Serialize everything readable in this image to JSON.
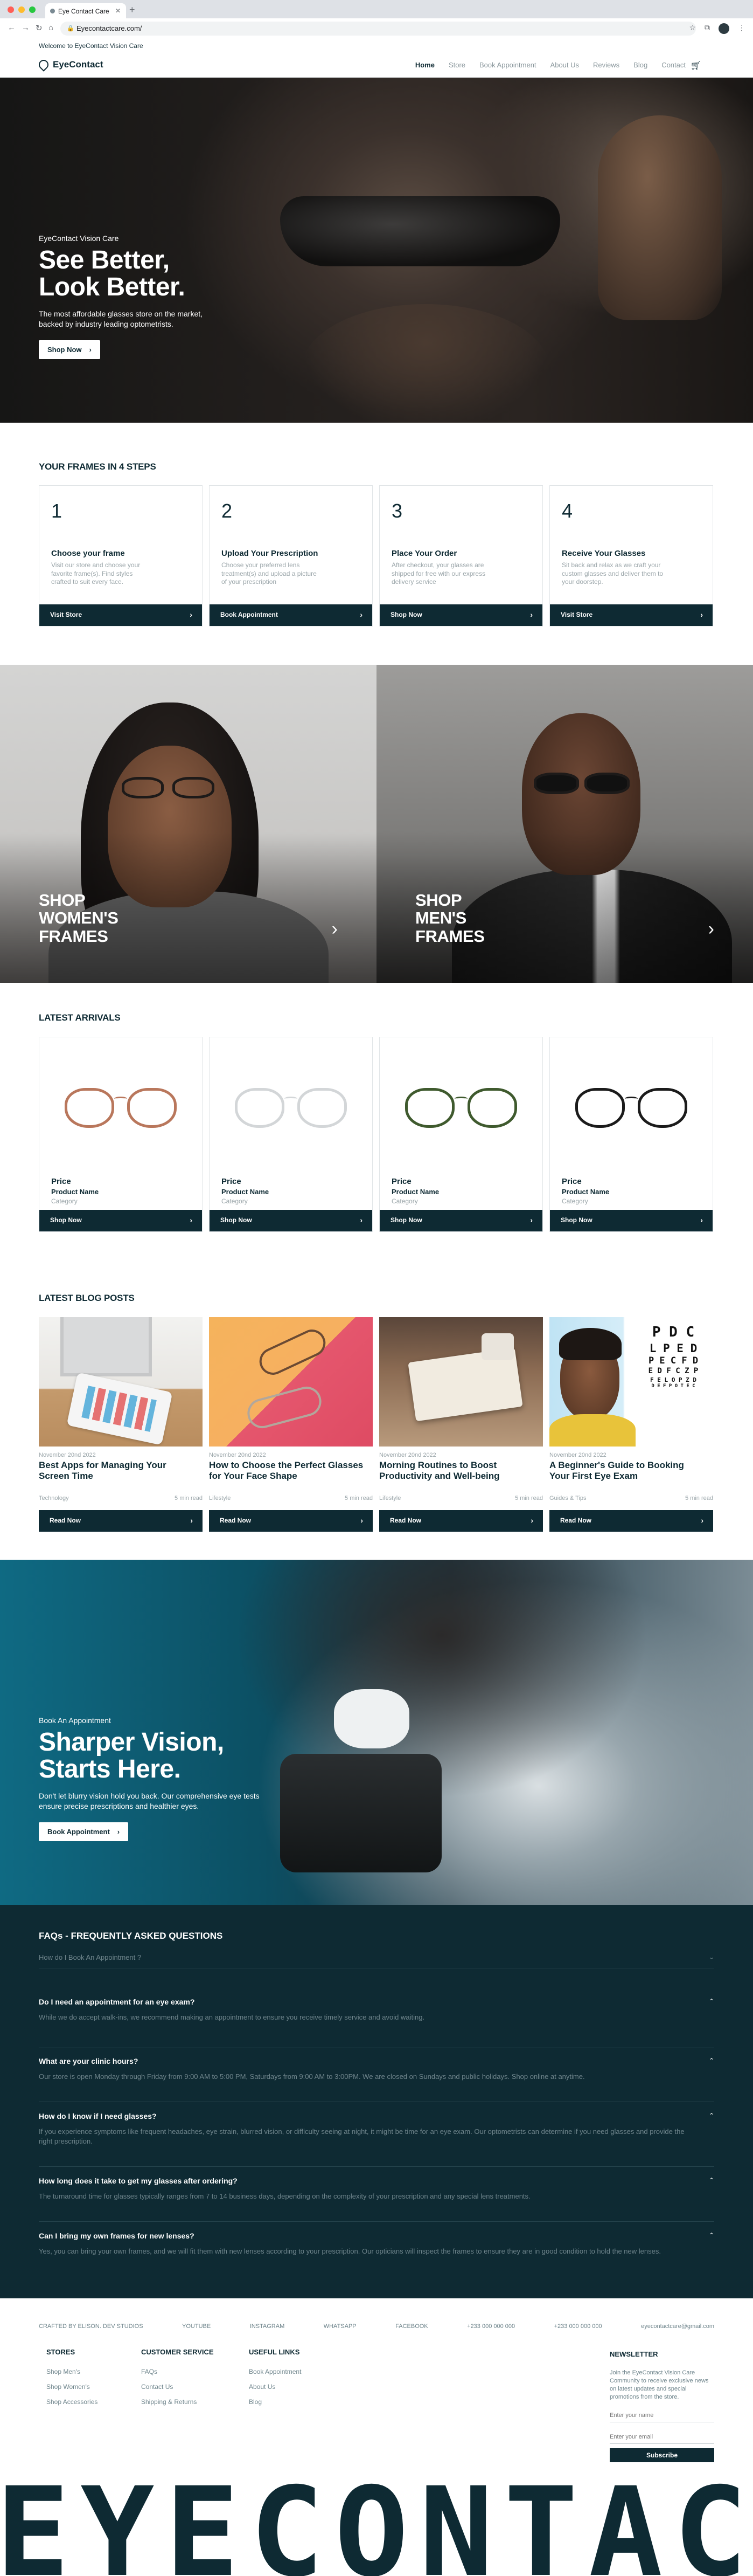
{
  "browser": {
    "tab_title": "Eye Contact Care",
    "url": "Eyecontactcare.com/"
  },
  "announcement": "Welcome to EyeContact Vision Care",
  "header": {
    "logo_text": "EyeContact",
    "nav": [
      "Home",
      "Store",
      "Book Appointment",
      "About Us",
      "Reviews",
      "Blog",
      "Contact"
    ],
    "active_nav": "Home",
    "cart_icon": "cart-icon"
  },
  "hero": {
    "eyebrow": "EyeContact Vision Care",
    "title_line1": "See Better,",
    "title_line2": "Look Better.",
    "subtitle": "The most affordable glasses store on the market, backed by industry leading optometrists.",
    "button": "Shop Now"
  },
  "steps": {
    "title": "YOUR FRAMES IN 4 STEPS",
    "items": [
      {
        "num": "1",
        "title": "Choose your frame",
        "desc": "Visit our store and choose your favorite frame(s). Find styles crafted to suit every face.",
        "button": "Visit Store"
      },
      {
        "num": "2",
        "title": "Upload Your Prescription",
        "desc": "Choose your preferred lens treatment(s) and upload a picture of your prescription",
        "button": "Book Appointment"
      },
      {
        "num": "3",
        "title": "Place Your Order",
        "desc": "After checkout, your glasses are shipped for free with our express delivery service",
        "button": "Shop Now"
      },
      {
        "num": "4",
        "title": "Receive Your Glasses",
        "desc": "Sit back and relax as we craft your custom glasses and deliver them to your doorstep.",
        "button": "Visit Store"
      }
    ]
  },
  "shop_panels": {
    "women": {
      "line1": "SHOP",
      "line2": "WOMEN'S",
      "line3": "FRAMES"
    },
    "men": {
      "line1": "SHOP",
      "line2": "MEN'S",
      "line3": "FRAMES"
    }
  },
  "arrivals": {
    "title": "LATEST ARRIVALS",
    "items": [
      {
        "price": "Price",
        "name": "Product Name",
        "category": "Category",
        "button": "Shop Now",
        "frame_color": "#b9775c"
      },
      {
        "price": "Price",
        "name": "Product Name",
        "category": "Category",
        "button": "Shop Now",
        "frame_color": "#d3d6d8"
      },
      {
        "price": "Price",
        "name": "Product Name",
        "category": "Category",
        "button": "Shop Now",
        "frame_color": "#3f5a2e"
      },
      {
        "price": "Price",
        "name": "Product Name",
        "category": "Category",
        "button": "Shop Now",
        "frame_color": "#1b1b1b"
      }
    ]
  },
  "blog": {
    "title": "LATEST BLOG POSTS",
    "items": [
      {
        "date": "November 20nd 2022",
        "title": "Best Apps for Managing Your Screen Time",
        "category": "Technology",
        "read": "5 min read",
        "button": "Read Now"
      },
      {
        "date": "November 20nd 2022",
        "title": "How to Choose the Perfect Glasses for Your Face Shape",
        "category": "Lifestyle",
        "read": "5 min read",
        "button": "Read Now"
      },
      {
        "date": "November 20nd 2022",
        "title": "Morning Routines to Boost Productivity and Well-being",
        "category": "Lifestyle",
        "read": "5 min read",
        "button": "Read Now"
      },
      {
        "date": "November 20nd 2022",
        "title": "A Beginner's Guide to Booking Your First Eye Exam",
        "category": "Guides & Tips",
        "read": "5 min read",
        "button": "Read Now"
      }
    ],
    "eye_chart_rows": [
      "P D C",
      "L P E D",
      "P E C F D",
      "E D F C Z P",
      "F E L O P Z D",
      "D E F P O T E C"
    ]
  },
  "appointment": {
    "eyebrow": "Book An Appointment",
    "title_line1": "Sharper Vision,",
    "title_line2": "Starts Here.",
    "subtitle": "Don't let blurry vision hold you back. Our comprehensive eye tests ensure precise prescriptions and healthier eyes.",
    "button": "Book Appointment"
  },
  "faq": {
    "title": "FAQs - FREQUENTLY ASKED QUESTIONS",
    "collapsed_question": "How do I Book An Appointment ?",
    "items": [
      {
        "q": "Do I need an appointment for an eye exam?",
        "a": "While we do accept walk-ins, we recommend making an appointment to ensure you receive timely service and avoid waiting."
      },
      {
        "q": "What are your clinic hours?",
        "a": "Our store is open Monday through Friday from 9:00 AM to 5:00 PM, Saturdays from 9:00 AM to 3:00PM. We are closed on Sundays and public holidays. Shop online at anytime."
      },
      {
        "q": "How do I know if I need glasses?",
        "a": "If you experience symptoms like frequent headaches, eye strain, blurred vision, or difficulty seeing at night, it might be time for an eye exam. Our optometrists can determine if you need glasses and provide the right prescription."
      },
      {
        "q": "How long does it take to get my glasses after ordering?",
        "a": "The turnaround time for glasses typically ranges from 7 to 14 business days, depending on the complexity of your prescription and any special lens treatments."
      },
      {
        "q": "Can I bring my own frames for new lenses?",
        "a": "Yes, you can bring your own frames, and we will fit them with new lenses according to your prescription. Our opticians will inspect the frames to ensure they are in good condition to hold the new lenses."
      }
    ]
  },
  "footer": {
    "top_links": [
      "CRAFTED BY ELISON. DEV STUDIOS",
      "YOUTUBE",
      "INSTAGRAM",
      "WHATSAPP",
      "FACEBOOK",
      "+233 000 000 000",
      "+233 000 000 000",
      "eyecontactcare@gmail.com"
    ],
    "stores_title": "STORES",
    "stores": [
      "Shop Men's",
      "Shop Women's",
      "Shop Accessories"
    ],
    "service_title": "CUSTOMER SERVICE",
    "service": [
      "FAQs",
      "Contact Us",
      "Shipping & Returns"
    ],
    "useful_title": "USEFUL LINKS",
    "useful": [
      "Book Appointment",
      "About Us",
      "Blog"
    ],
    "newsletter": {
      "title": "NEWSLETTER",
      "desc": "Join the EyeContact Vision Care Community to receive exclusive news on latest updates and special promotions from the store.",
      "name_placeholder": "Enter your name",
      "email_placeholder": "Enter your email",
      "button": "Subscribe"
    },
    "wordmark": "EYECONTACT"
  }
}
